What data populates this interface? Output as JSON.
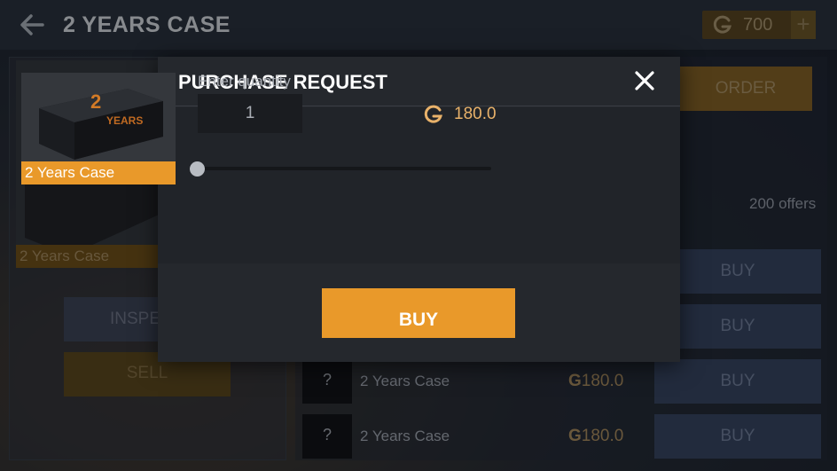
{
  "header": {
    "title": "2 YEARS CASE",
    "currency_amount": "700",
    "plus_label": "+"
  },
  "background": {
    "case_label": "2 Years Case",
    "inspect_label": "INSPE",
    "sell_label": "SELL",
    "order_label": "ORDER",
    "offers_count": "200 offers",
    "listings": [
      {
        "thumb": "?",
        "name": "2 Years Case",
        "price": "180.0",
        "buy_label": "BUY"
      },
      {
        "thumb": "?",
        "name": "2 Years Case",
        "price": "180.0",
        "buy_label": "BUY"
      }
    ],
    "extra_buy_labels": [
      "BUY",
      "BUY"
    ]
  },
  "modal": {
    "title": "PURCHASE REQUEST",
    "item_label": "2 Years Case",
    "quantity_label": "Enter quantity",
    "quantity_value": "1",
    "price": "180.0",
    "buy_label": "BUY",
    "slider_value": 0
  },
  "colors": {
    "accent": "#e9992a",
    "price_text": "#e9b26a"
  },
  "icons": {
    "back": "back-arrow-icon",
    "currency": "g-coin-icon",
    "close": "close-icon"
  }
}
